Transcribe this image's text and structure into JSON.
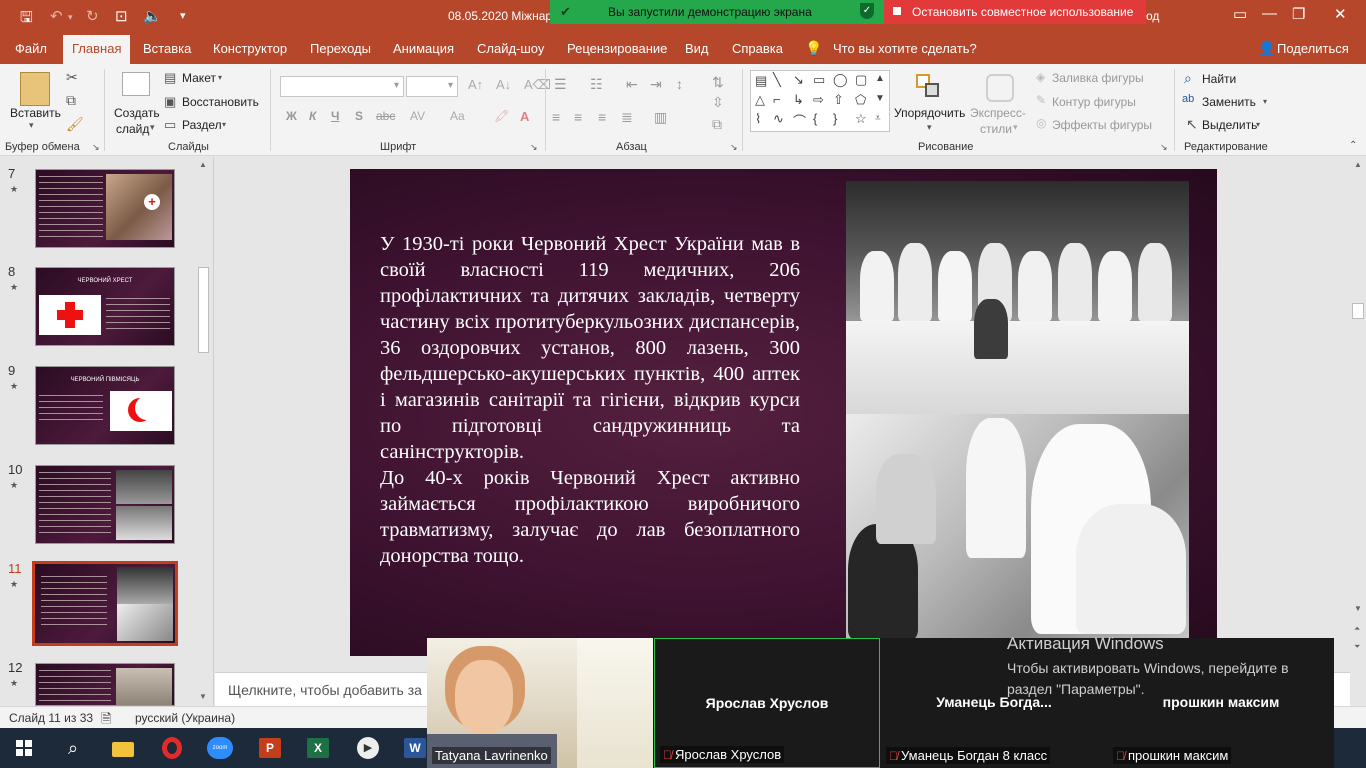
{
  "title_bar": {
    "document_title": "08.05.2020 Міжнаро",
    "title_fragment": "од",
    "share_green_text": "Вы запустили демонстрацию экрана",
    "share_red_text": "Остановить совместное использование"
  },
  "menu": {
    "tabs": [
      "Файл",
      "Главная",
      "Вставка",
      "Конструктор",
      "Переходы",
      "Анимация",
      "Слайд-шоу",
      "Рецензирование",
      "Вид",
      "Справка"
    ],
    "tell_me": "Что вы хотите сделать?",
    "share": "Поделиться"
  },
  "ribbon": {
    "clipboard": {
      "paste": "Вставить",
      "label": "Буфер обмена"
    },
    "slides": {
      "new_slide_1": "Создать",
      "new_slide_2": "слайд",
      "layout": "Макет",
      "reset": "Восстановить",
      "section": "Раздел",
      "label": "Слайды"
    },
    "font": {
      "label": "Шрифт",
      "bold": "Ж",
      "italic": "К",
      "underline": "Ч",
      "strike": "S",
      "abc": "abc"
    },
    "paragraph": {
      "label": "Абзац"
    },
    "drawing": {
      "arrange": "Упорядочить",
      "quick_styles_1": "Экспресс-",
      "quick_styles_2": "стили",
      "fill": "Заливка фигуры",
      "outline": "Контур фигуры",
      "effects": "Эффекты фигуры",
      "label": "Рисование"
    },
    "editing": {
      "find": "Найти",
      "replace": "Заменить",
      "select": "Выделить",
      "label": "Редактирование"
    }
  },
  "thumbnails": [
    {
      "num": "7",
      "star": "★",
      "title": ""
    },
    {
      "num": "8",
      "star": "★",
      "title": "ЧЕРВОНИЙ ХРЕСТ"
    },
    {
      "num": "9",
      "star": "★",
      "title": "ЧЕРВОНИЙ ПІВМІСЯЦЬ"
    },
    {
      "num": "10",
      "star": "★",
      "title": ""
    },
    {
      "num": "11",
      "star": "★",
      "title": ""
    },
    {
      "num": "12",
      "star": "★",
      "title": ""
    }
  ],
  "slide": {
    "paragraph_1": "У 1930-ті роки Червоний Хрест України мав в своїй власності 119 медичних, 206 профілактичних та дитячих закладів, четверту частину всіх протитуберкульозних диспансерів, 36 оздоровчих установ, 800 лазень, 300 фельдшерсько-акушерських пунктів, 400 аптек і магазинів санітарії та гігієни, відкрив курси по підготовці сандружинниць та санінструкторів.",
    "paragraph_2": "До 40-х років Червоний Хрест активно займається профілактикою виробничого травматизму, залучає до лав безоплатного донорства тощо."
  },
  "notes_placeholder": "Щелкните, чтобы добавить за",
  "status": {
    "slide_counter": "Слайд 11 из 33",
    "language": "русский (Украина)"
  },
  "zoom": {
    "participants": [
      {
        "name": "Tatyana Lavrinenko",
        "tile_name": "",
        "muted": false
      },
      {
        "name": "Ярослав Хруслов",
        "tile_name": "Ярослав Хруслов",
        "muted": true
      },
      {
        "name": "Уманець Богдан 8 класс",
        "tile_name": "Уманець  Богда...",
        "muted": true
      },
      {
        "name": "прошкин максим",
        "tile_name": "прошкин максим",
        "muted": true
      }
    ]
  },
  "activation": {
    "title": "Активация Windows",
    "line1": "Чтобы активировать Windows, перейдите в",
    "line2": "раздел \"Параметры\"."
  },
  "colors": {
    "accent": "#b7472a",
    "active_thumb": "#c43e1c",
    "green_banner": "#24a84b",
    "red_banner": "#e23a3a"
  }
}
